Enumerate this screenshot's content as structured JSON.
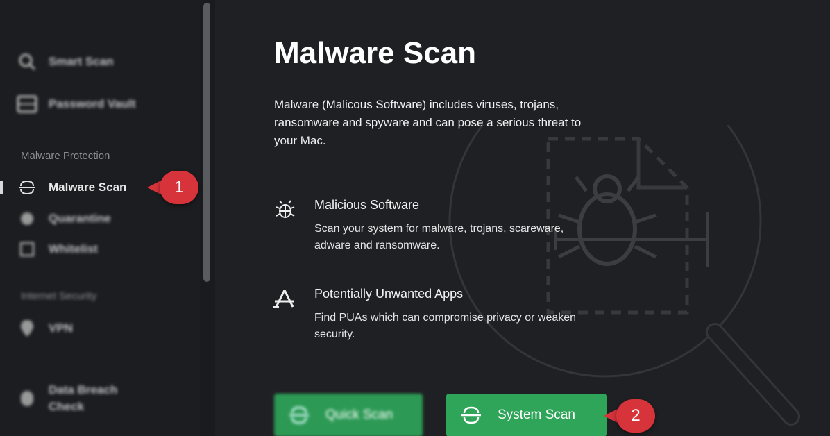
{
  "sidebar": {
    "items": [
      {
        "label": "Smart Scan",
        "icon": "magnifier-icon",
        "blurred": true
      },
      {
        "label": "Password Vault",
        "icon": "vault-icon",
        "blurred": true
      },
      {
        "label": "Malware Scan",
        "icon": "malware-scan-icon",
        "blurred": false
      },
      {
        "label": "Quarantine",
        "icon": "quarantine-icon",
        "blurred": true
      },
      {
        "label": "Whitelist",
        "icon": "whitelist-icon",
        "blurred": true
      },
      {
        "label": "VPN",
        "icon": "location-pin-icon",
        "blurred": true
      },
      {
        "label": "Data Breach\nCheck",
        "icon": "data-breach-icon",
        "blurred": true
      }
    ],
    "sections": {
      "malware": "Malware Protection",
      "internet": "Internet Security"
    }
  },
  "callouts": {
    "one": "1",
    "two": "2",
    "color": "#d7333b"
  },
  "main": {
    "title": "Malware Scan",
    "description": "Malware (Malicous Software) includes viruses, trojans, ransomware and spyware and can pose a serious threat to your Mac.",
    "features": [
      {
        "title": "Malicious Software",
        "description": "Scan your system for malware, trojans, scareware, adware and ransomware.",
        "icon": "bug-icon"
      },
      {
        "title": "Potentially Unwanted Apps",
        "description": "Find PUAs which can compromise privacy or weaken security.",
        "icon": "app-store-icon"
      }
    ],
    "buttons": {
      "quick_scan": "Quick Scan",
      "system_scan": "System Scan"
    },
    "accent": "#2fa55a"
  }
}
